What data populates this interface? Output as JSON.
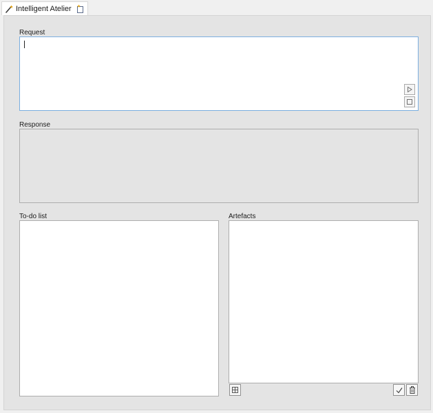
{
  "tab": {
    "title": "Intelligent Atelier",
    "icon": "magic-wand-icon",
    "new_tab_icon": "new-tab-icon"
  },
  "request": {
    "label": "Request",
    "value": "",
    "send_icon": "play-icon",
    "stop_icon": "stop-icon"
  },
  "response": {
    "label": "Response",
    "value": ""
  },
  "todo": {
    "label": "To-do list",
    "items": []
  },
  "artefacts": {
    "label": "Artefacts",
    "items": [],
    "add_icon": "grid-add-icon",
    "accept_icon": "checkmark-icon",
    "delete_icon": "trash-icon"
  },
  "colors": {
    "focus_border": "#7aaee0",
    "panel_background": "#e4e4e4"
  }
}
